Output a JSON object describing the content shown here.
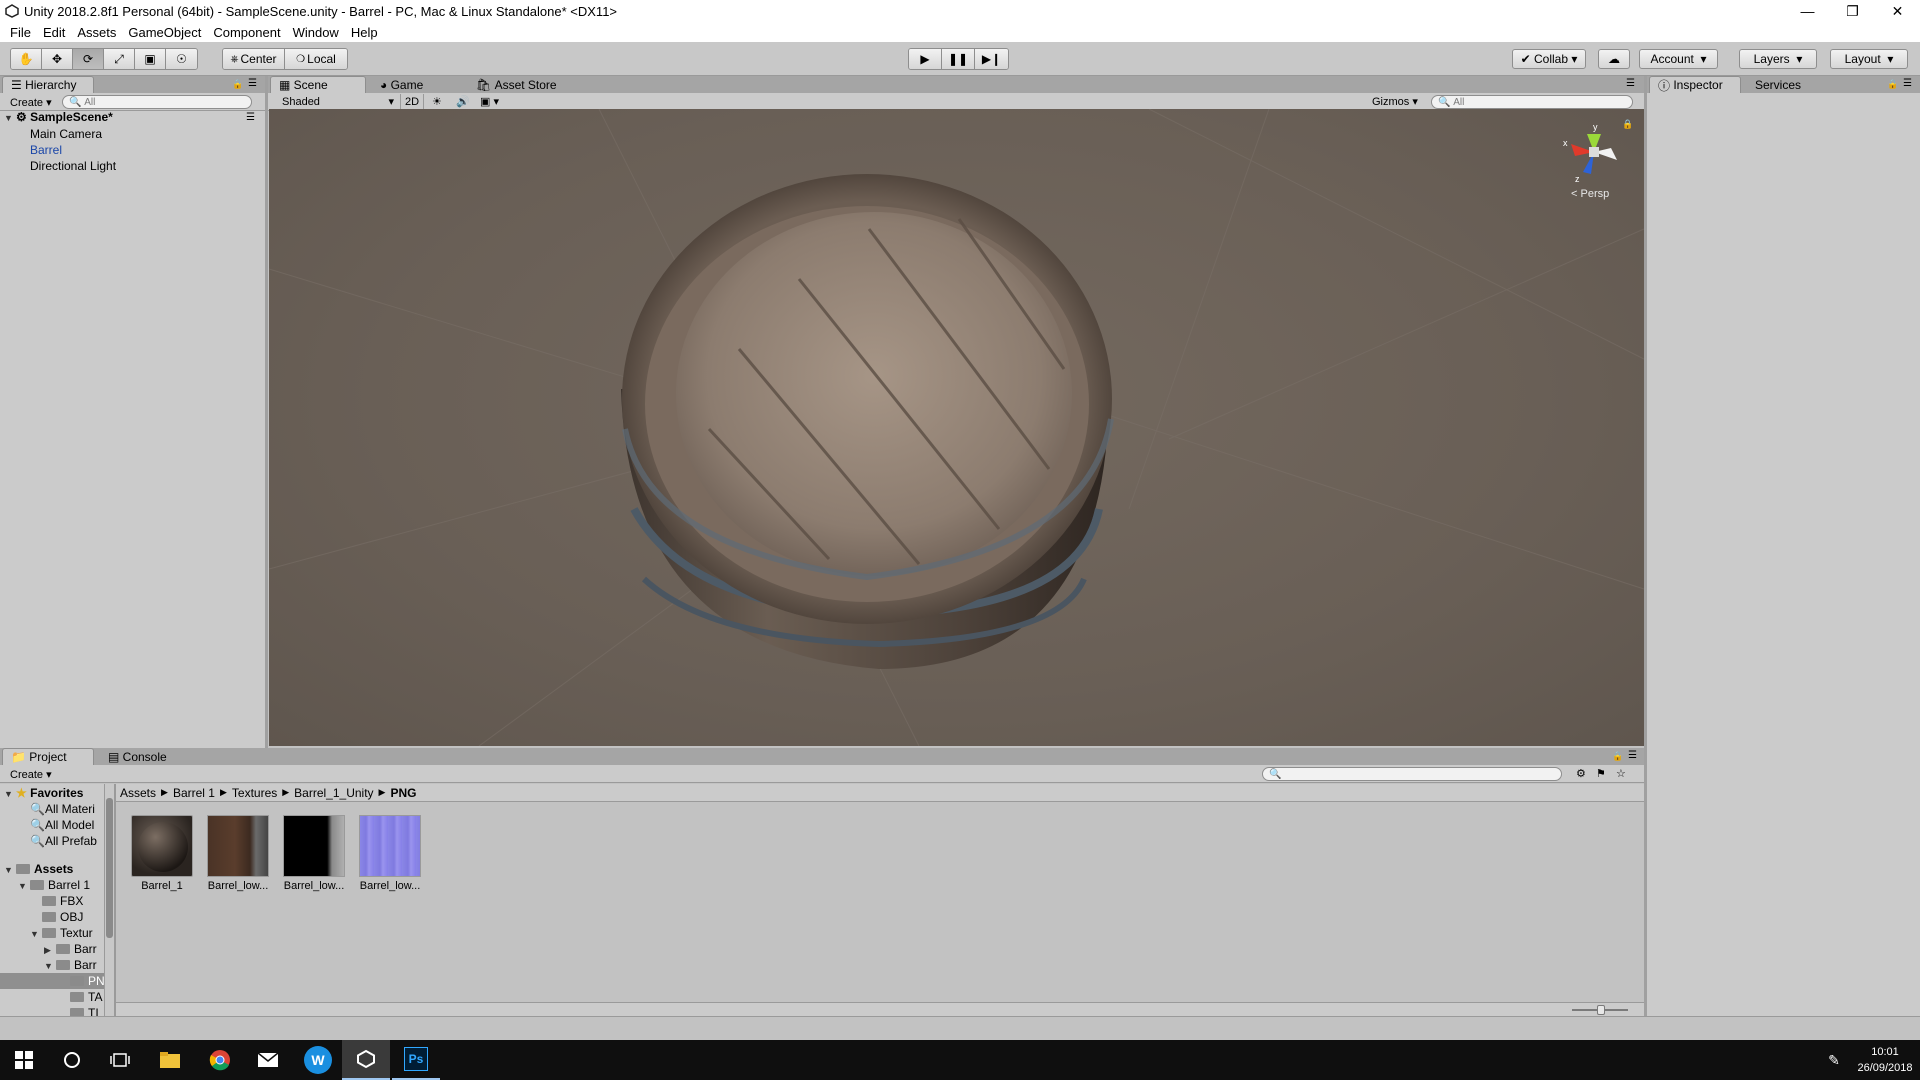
{
  "window": {
    "title": "Unity 2018.2.8f1 Personal (64bit) - SampleScene.unity - Barrel - PC, Mac & Linux Standalone* <DX11>",
    "controls": [
      "minimize-icon",
      "restore-icon",
      "close-icon"
    ]
  },
  "menu": [
    "File",
    "Edit",
    "Assets",
    "GameObject",
    "Component",
    "Window",
    "Help"
  ],
  "toolbar": {
    "tools": [
      "hand-icon",
      "move-icon",
      "rotate-icon",
      "scale-icon",
      "rect-icon",
      "transform-icon"
    ],
    "pivot": "Center",
    "space": "Local",
    "collab": "Collab",
    "account": "Account",
    "layers": "Layers",
    "layout": "Layout"
  },
  "hierarchy": {
    "tab": "Hierarchy",
    "create": "Create",
    "search_placeholder": "All",
    "scene_name": "SampleScene*",
    "items": [
      "Main Camera",
      "Barrel",
      "Directional Light"
    ],
    "selected": "Barrel"
  },
  "scene_view": {
    "tabs": [
      "Scene",
      "Game",
      "Asset Store"
    ],
    "active_tab": "Scene",
    "shading": "Shaded",
    "mode_2d": "2D",
    "gizmos": "Gizmos",
    "search_placeholder": "All",
    "gizmo_axes": [
      "y",
      "x",
      "z"
    ],
    "projection": "Persp"
  },
  "inspector": {
    "tabs": [
      "Inspector",
      "Services"
    ],
    "active_tab": "Inspector"
  },
  "project": {
    "tabs": [
      "Project",
      "Console"
    ],
    "active_tab": "Project",
    "create": "Create",
    "favorites_label": "Favorites",
    "favorites": [
      "All Materi",
      "All Model",
      "All Prefab"
    ],
    "assets_label": "Assets",
    "tree": [
      {
        "label": "Barrel 1",
        "indent": 1
      },
      {
        "label": "FBX",
        "indent": 2
      },
      {
        "label": "OBJ",
        "indent": 2
      },
      {
        "label": "Textur",
        "indent": 2
      },
      {
        "label": "Barr",
        "indent": 3
      },
      {
        "label": "Barr",
        "indent": 3
      },
      {
        "label": "PN",
        "indent": 4
      },
      {
        "label": "TA",
        "indent": 4
      },
      {
        "label": "TI",
        "indent": 4
      }
    ],
    "breadcrumb": [
      "Assets",
      "Barrel 1",
      "Textures",
      "Barrel_1_Unity",
      "PNG"
    ],
    "files": [
      {
        "label": "Barrel_1",
        "kind": "material"
      },
      {
        "label": "Barrel_low...",
        "kind": "albedo"
      },
      {
        "label": "Barrel_low...",
        "kind": "metallic"
      },
      {
        "label": "Barrel_low...",
        "kind": "normal"
      }
    ]
  },
  "taskbar": {
    "time": "10:01",
    "date": "26/09/2018",
    "apps": [
      "windows-start-icon",
      "search-circle-icon",
      "task-view-icon",
      "file-explorer-icon",
      "chrome-icon",
      "mail-icon",
      "unity-hub-icon",
      "unity-icon",
      "photoshop-icon"
    ],
    "ps_label": "Ps",
    "w_label": "W"
  },
  "colors": {
    "editor_bg": "#c2c2c2",
    "scene_bg": "#6b6158",
    "selected_text": "#1a46a8",
    "taskbar": "#0f0f0f"
  }
}
